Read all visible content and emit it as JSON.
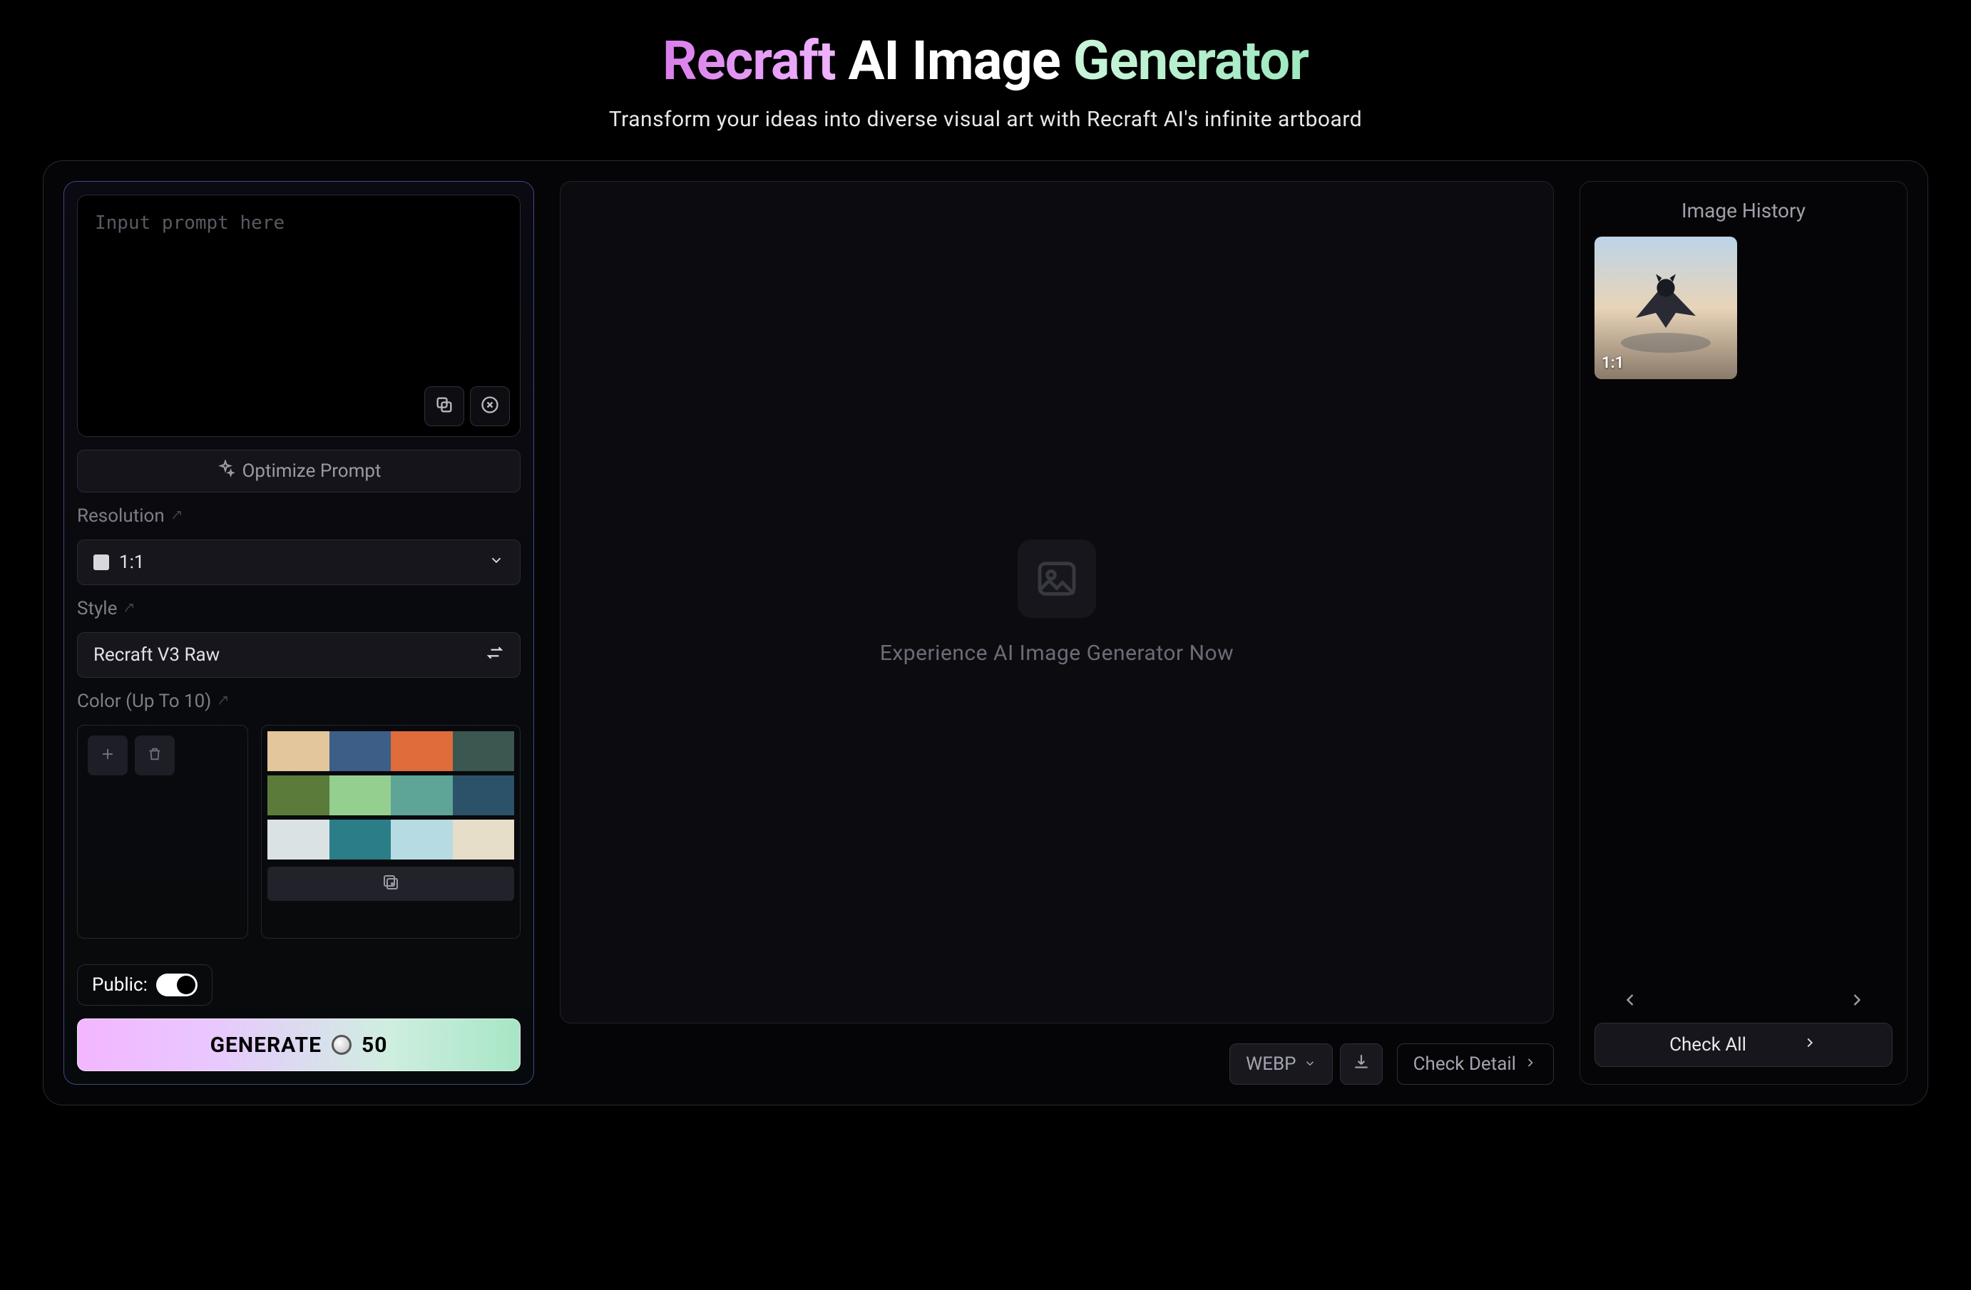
{
  "hero": {
    "title_w1": "Recraft",
    "title_w2": "AI",
    "title_w3": "Image",
    "title_w4": "Generator",
    "subtitle": "Transform your ideas into diverse visual art with Recraft AI's infinite artboard"
  },
  "prompt": {
    "placeholder": "Input prompt here",
    "value": ""
  },
  "optimize_label": "Optimize Prompt",
  "resolution": {
    "label": "Resolution",
    "value": "1:1"
  },
  "style": {
    "label": "Style",
    "value": "Recraft V3 Raw"
  },
  "color": {
    "label": "Color (Up To 10)",
    "palettes": [
      [
        "#e3c69b",
        "#3d5e86",
        "#df6c3a",
        "#3c5650"
      ],
      [
        "#5a7b3a",
        "#95cf90",
        "#5ea598",
        "#2b5269"
      ],
      [
        "#dbe2e3",
        "#2b7e88",
        "#b6dbe3",
        "#e6dec9"
      ]
    ]
  },
  "public": {
    "label": "Public:",
    "value": true
  },
  "generate": {
    "label": "GENERATE",
    "cost": "50"
  },
  "canvas": {
    "empty_text": "Experience AI Image Generator Now"
  },
  "footer": {
    "format": "WEBP",
    "detail_label": "Check Detail"
  },
  "history": {
    "title": "Image History",
    "items": [
      {
        "ratio": "1:1"
      }
    ],
    "check_all": "Check All"
  }
}
